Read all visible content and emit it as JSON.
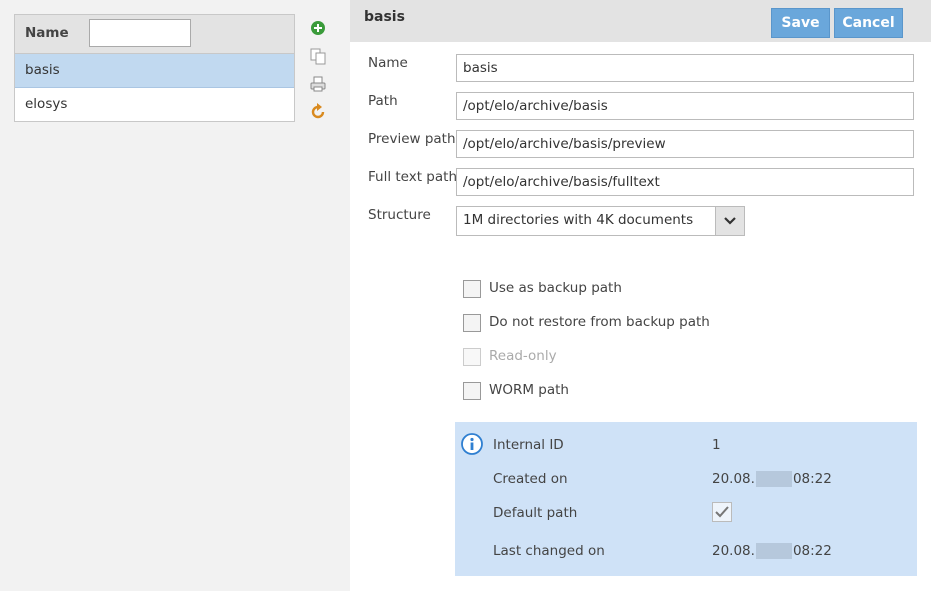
{
  "left": {
    "list": {
      "header_label": "Name",
      "filter_value": "",
      "rows": [
        "basis",
        "elosys"
      ],
      "selected": "basis"
    },
    "tools": [
      "add-icon",
      "copy-icon",
      "print-icon",
      "refresh-icon"
    ]
  },
  "right": {
    "title": "basis",
    "save_label": "Save",
    "cancel_label": "Cancel",
    "fields": {
      "name": {
        "label": "Name",
        "value": "basis"
      },
      "path": {
        "label": "Path",
        "value": "/opt/elo/archive/basis"
      },
      "preview": {
        "label": "Preview path",
        "value": "/opt/elo/archive/basis/preview"
      },
      "fulltext": {
        "label": "Full text path",
        "value": "/opt/elo/archive/basis/fulltext"
      },
      "structure": {
        "label": "Structure",
        "value": "1M directories with 4K documents"
      }
    },
    "checkboxes": {
      "backup": {
        "label": "Use as backup path",
        "checked": false
      },
      "no_restore": {
        "label": "Do not restore from backup path",
        "checked": false
      },
      "readonly": {
        "label": "Read-only",
        "checked": false,
        "disabled": true
      },
      "worm": {
        "label": "WORM path",
        "checked": false
      }
    },
    "info": {
      "internal_id": {
        "label": "Internal ID",
        "value": "1"
      },
      "created_on": {
        "label": "Created on",
        "date_prefix": "20.08.",
        "time": "08:22"
      },
      "default_path": {
        "label": "Default path",
        "checked": true
      },
      "last_changed": {
        "label": "Last changed on",
        "date_prefix": "20.08.",
        "time": "08:22"
      }
    }
  },
  "colors": {
    "accent": "#6aa7db",
    "selected_row": "#c1d9f0",
    "info_panel": "#cfe2f7",
    "header_bg": "#e3e3e3"
  }
}
